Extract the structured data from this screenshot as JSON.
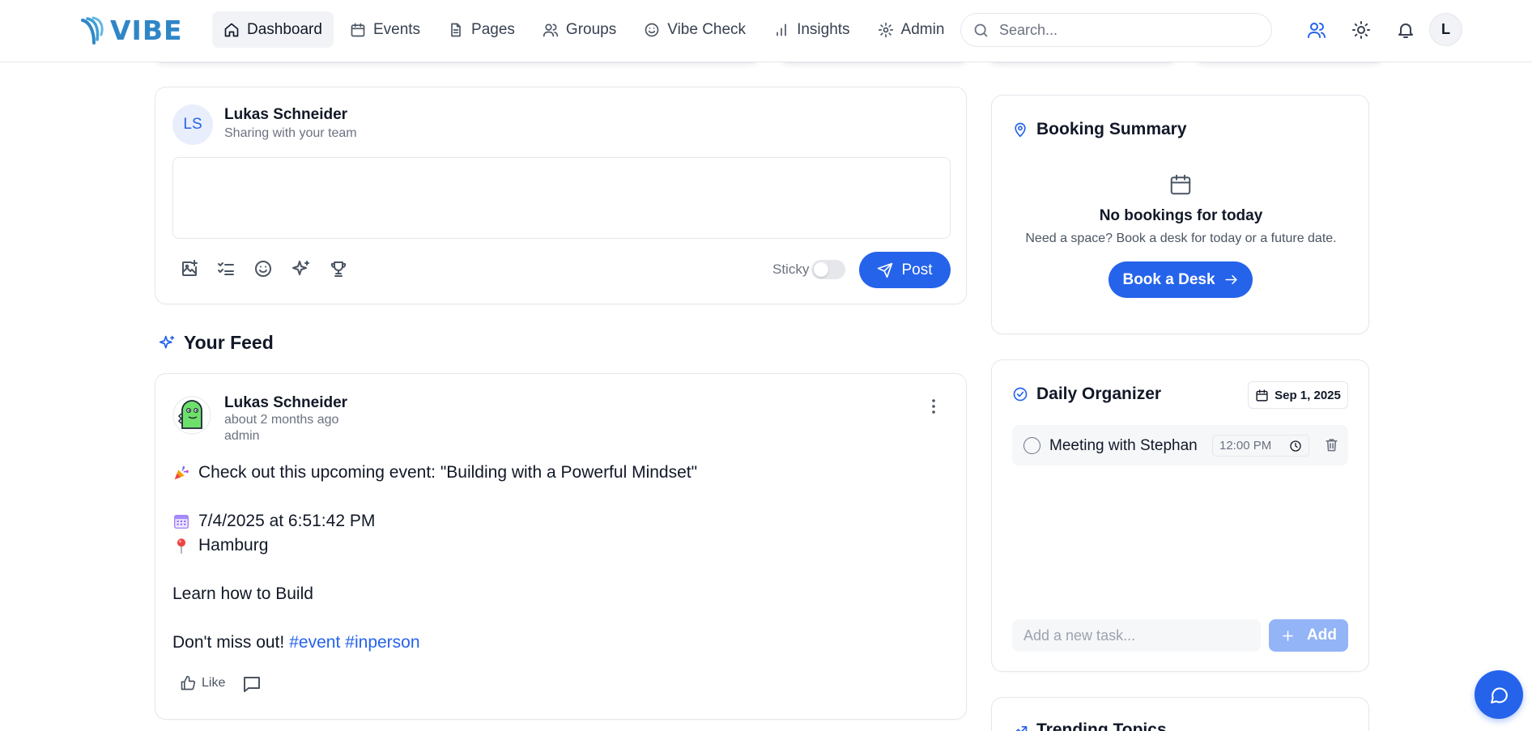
{
  "brand": {
    "name": "VIBE",
    "color": "#2f86c7"
  },
  "nav": {
    "items": [
      {
        "label": "Dashboard",
        "icon": "home-icon",
        "active": true
      },
      {
        "label": "Events",
        "icon": "calendar-icon"
      },
      {
        "label": "Pages",
        "icon": "file-icon"
      },
      {
        "label": "Groups",
        "icon": "users-icon"
      },
      {
        "label": "Vibe Check",
        "icon": "smile-icon"
      },
      {
        "label": "Insights",
        "icon": "bar-chart-icon"
      },
      {
        "label": "Admin",
        "icon": "gear-icon"
      }
    ]
  },
  "search": {
    "placeholder": "Search..."
  },
  "header_icons": [
    "users-icon",
    "sun-icon",
    "bell-icon"
  ],
  "user_avatar_initial": "L",
  "composer": {
    "initials": "LS",
    "name": "Lukas Schneider",
    "subtitle": "Sharing with your team",
    "tools": [
      "image-add-icon",
      "checklist-icon",
      "smile-icon",
      "sparkles-icon",
      "trophy-icon"
    ],
    "sticky_label": "Sticky",
    "sticky_on": false,
    "post_label": "Post"
  },
  "feed": {
    "heading": "Your Feed",
    "post": {
      "author": "Lukas Schneider",
      "time": "about 2 months ago",
      "role": "admin",
      "event_line": "Check out this upcoming event: \"Building with a Powerful Mindset\"",
      "date_line": "7/4/2025 at 6:51:42 PM",
      "location_line": "Hamburg",
      "description": "Learn how to Build",
      "cta": "Don't miss out!",
      "tags": [
        "#event",
        "#inperson"
      ],
      "like_label": "Like"
    }
  },
  "booking": {
    "title": "Booking Summary",
    "empty_title": "No bookings for today",
    "empty_subtitle": "Need a space? Book a desk for today or a future date.",
    "button_label": "Book a Desk"
  },
  "organizer": {
    "title": "Daily Organizer",
    "date": "Sep 1, 2025",
    "tasks": [
      {
        "text": "Meeting with Stephan",
        "time": "12:00 PM",
        "done": false
      }
    ],
    "new_task_placeholder": "Add a new task...",
    "add_label": "Add"
  },
  "trending": {
    "title": "Trending Topics"
  },
  "colors": {
    "accent": "#2563eb",
    "accent_disabled": "#93b4f7",
    "border": "#e5e7eb",
    "muted": "#6b7280"
  }
}
